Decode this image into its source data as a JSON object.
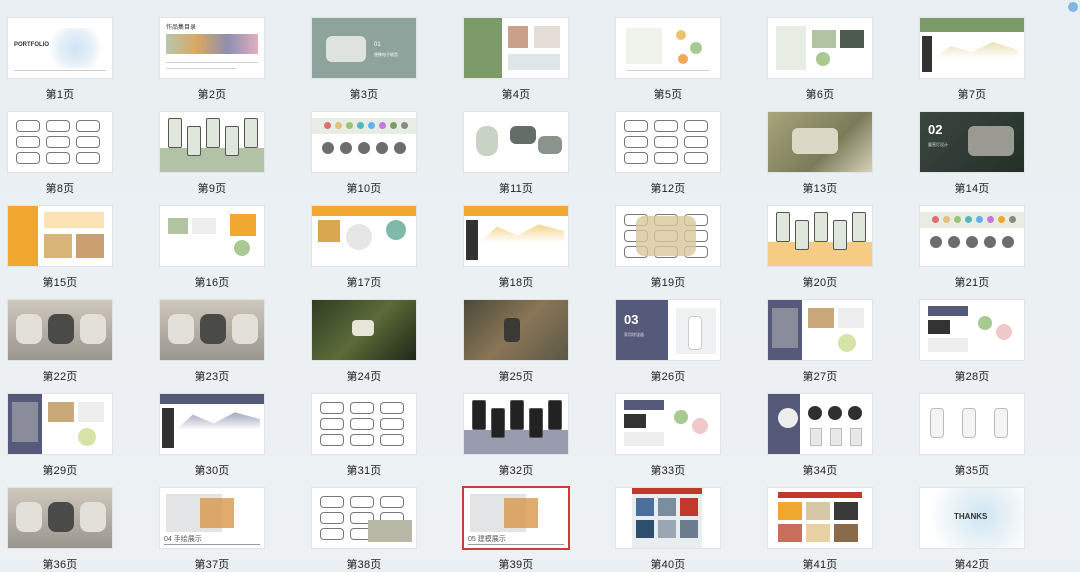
{
  "pages": [
    {
      "label": "第1页",
      "title": "PORTFOLIO"
    },
    {
      "label": "第2页",
      "title": "作品集目录"
    },
    {
      "label": "第3页",
      "big": "01",
      "sub": "便携电子收音"
    },
    {
      "label": "第4页"
    },
    {
      "label": "第5页"
    },
    {
      "label": "第6页"
    },
    {
      "label": "第7页"
    },
    {
      "label": "第8页"
    },
    {
      "label": "第9页"
    },
    {
      "label": "第10页"
    },
    {
      "label": "第11页"
    },
    {
      "label": "第12页"
    },
    {
      "label": "第13页"
    },
    {
      "label": "第14页",
      "big": "02",
      "sub": "露营灯设计"
    },
    {
      "label": "第15页"
    },
    {
      "label": "第16页"
    },
    {
      "label": "第17页"
    },
    {
      "label": "第18页"
    },
    {
      "label": "第19页"
    },
    {
      "label": "第20页"
    },
    {
      "label": "第21页"
    },
    {
      "label": "第22页"
    },
    {
      "label": "第23页"
    },
    {
      "label": "第24页"
    },
    {
      "label": "第25页"
    },
    {
      "label": "第26页",
      "big": "03",
      "sub": "家用除湿器"
    },
    {
      "label": "第27页"
    },
    {
      "label": "第28页"
    },
    {
      "label": "第29页"
    },
    {
      "label": "第30页"
    },
    {
      "label": "第31页"
    },
    {
      "label": "第32页"
    },
    {
      "label": "第33页"
    },
    {
      "label": "第34页"
    },
    {
      "label": "第35页"
    },
    {
      "label": "第36页"
    },
    {
      "label": "第37页",
      "big": "04",
      "sub": "手绘展示"
    },
    {
      "label": "第38页"
    },
    {
      "label": "第39页",
      "big": "05",
      "sub": "建模展示"
    },
    {
      "label": "第40页"
    },
    {
      "label": "第41页"
    },
    {
      "label": "第42页",
      "title": "THANKS"
    }
  ],
  "selected_page": "第39页",
  "colors": {
    "background": "#e9eff2",
    "green": "#7d9a6b",
    "orange": "#f0a830",
    "navy": "#55597a",
    "dark": "#2a2f2d",
    "selection": "#cf3a3a"
  }
}
